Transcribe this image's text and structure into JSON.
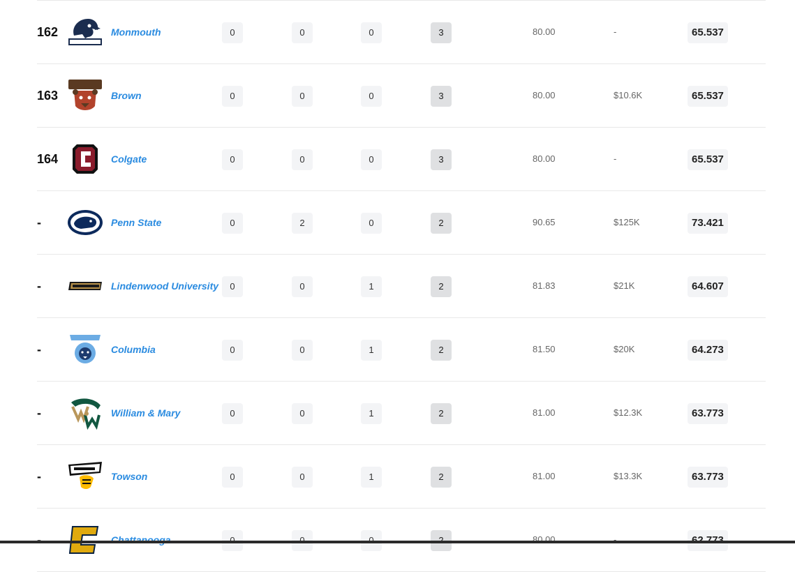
{
  "rows": [
    {
      "rank": "162",
      "team": "Monmouth",
      "logo": "monmouth-hawk-logo",
      "c1": "0",
      "c2": "0",
      "c3": "0",
      "c4": "3",
      "rating": "80.00",
      "nil": "-",
      "score": "65.537"
    },
    {
      "rank": "163",
      "team": "Brown",
      "logo": "brown-bear-logo",
      "c1": "0",
      "c2": "0",
      "c3": "0",
      "c4": "3",
      "rating": "80.00",
      "nil": "$10.6K",
      "score": "65.537"
    },
    {
      "rank": "164",
      "team": "Colgate",
      "logo": "colgate-c-logo",
      "c1": "0",
      "c2": "0",
      "c3": "0",
      "c4": "3",
      "rating": "80.00",
      "nil": "-",
      "score": "65.537"
    },
    {
      "rank": "-",
      "team": "Penn State",
      "logo": "penn-state-lion-logo",
      "c1": "0",
      "c2": "2",
      "c3": "0",
      "c4": "2",
      "rating": "90.65",
      "nil": "$125K",
      "score": "73.421"
    },
    {
      "rank": "-",
      "team": "Lindenwood University",
      "logo": "lindenwood-wordmark-logo",
      "c1": "0",
      "c2": "0",
      "c3": "1",
      "c4": "2",
      "rating": "81.83",
      "nil": "$21K",
      "score": "64.607"
    },
    {
      "rank": "-",
      "team": "Columbia",
      "logo": "columbia-lion-logo",
      "c1": "0",
      "c2": "0",
      "c3": "1",
      "c4": "2",
      "rating": "81.50",
      "nil": "$20K",
      "score": "64.273"
    },
    {
      "rank": "-",
      "team": "William & Mary",
      "logo": "william-mary-logo",
      "c1": "0",
      "c2": "0",
      "c3": "1",
      "c4": "2",
      "rating": "81.00",
      "nil": "$12.3K",
      "score": "63.773"
    },
    {
      "rank": "-",
      "team": "Towson",
      "logo": "towson-tiger-logo",
      "c1": "0",
      "c2": "0",
      "c3": "1",
      "c4": "2",
      "rating": "81.00",
      "nil": "$13.3K",
      "score": "63.773"
    },
    {
      "rank": "-",
      "team": "Chattanooga",
      "logo": "chattanooga-c-logo",
      "c1": "0",
      "c2": "0",
      "c3": "0",
      "c4": "2",
      "rating": "80.00",
      "nil": "-",
      "score": "62.773"
    }
  ],
  "colors": {
    "link": "#2a8be0",
    "chip": "#f3f4f6",
    "chip_dark": "#dfe0e2"
  }
}
